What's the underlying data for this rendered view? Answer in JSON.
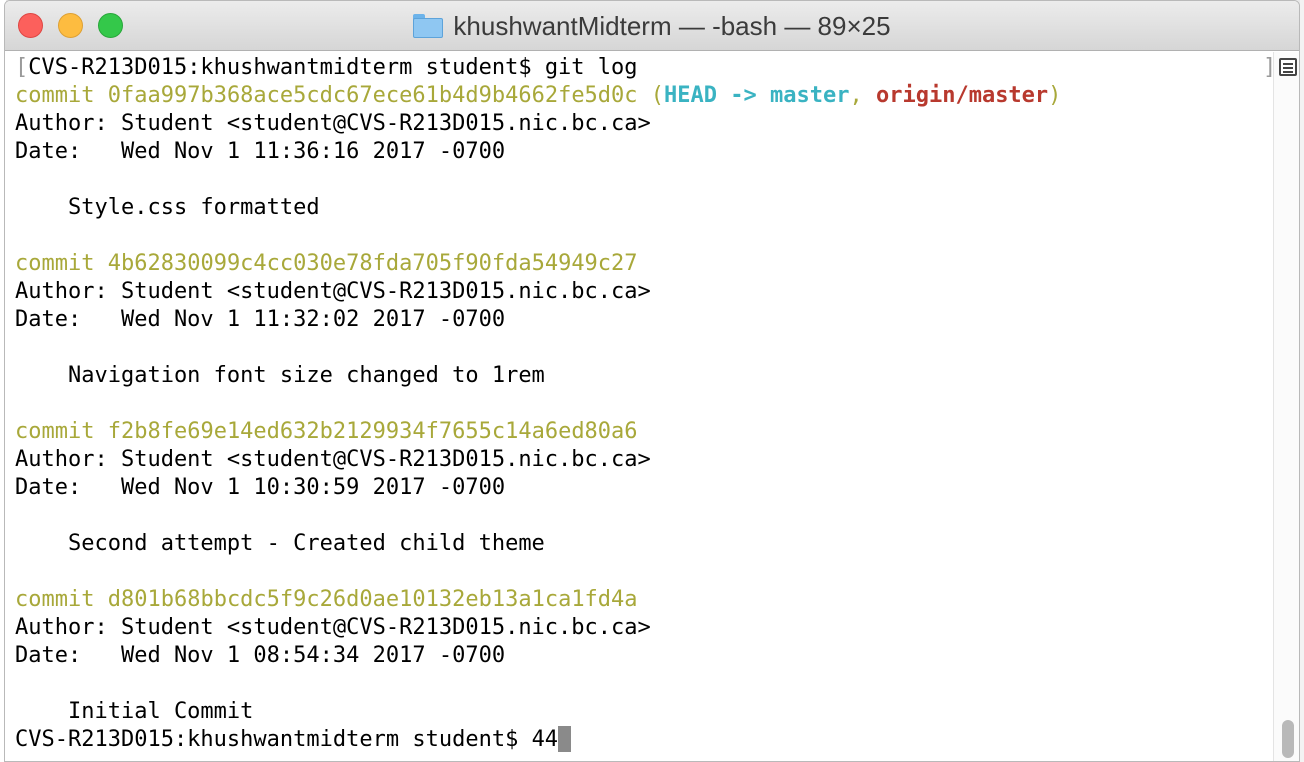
{
  "window": {
    "title": "khushwantMidterm — -bash — 89×25"
  },
  "terminal": {
    "prompt_line": {
      "prompt": "CVS-R213D015:khushwantmidterm student$ ",
      "command": "git log"
    },
    "commits": [
      {
        "label": "commit",
        "hash": "0faa997b368ace5cdc67ece61b4d9b4662fe5d0c",
        "refs": {
          "open": "(",
          "head": "HEAD -> master",
          "sep": ", ",
          "origin": "origin/master",
          "close": ")"
        },
        "author": "Author: Student <student@CVS-R213D015.nic.bc.ca>",
        "date": "Date:   Wed Nov 1 11:36:16 2017 -0700",
        "message": "    Style.css formatted"
      },
      {
        "label": "commit",
        "hash": "4b62830099c4cc030e78fda705f90fda54949c27",
        "author": "Author: Student <student@CVS-R213D015.nic.bc.ca>",
        "date": "Date:   Wed Nov 1 11:32:02 2017 -0700",
        "message": "    Navigation font size changed to 1rem"
      },
      {
        "label": "commit",
        "hash": "f2b8fe69e14ed632b2129934f7655c14a6ed80a6",
        "author": "Author: Student <student@CVS-R213D015.nic.bc.ca>",
        "date": "Date:   Wed Nov 1 10:30:59 2017 -0700",
        "message": "    Second attempt - Created child theme"
      },
      {
        "label": "commit",
        "hash": "d801b68bbcdc5f9c26d0ae10132eb13a1ca1fd4a",
        "author": "Author: Student <student@CVS-R213D015.nic.bc.ca>",
        "date": "Date:   Wed Nov 1 08:54:34 2017 -0700",
        "message": "    Initial Commit"
      }
    ],
    "final_prompt": {
      "prompt": "CVS-R213D015:khushwantmidterm student$ ",
      "input": "44"
    }
  },
  "colors": {
    "commit": "#a8a83a",
    "head": "#3ab3c2",
    "branch": "#3aa83a",
    "origin": "#b8392e"
  },
  "icons": {
    "title": "folder-icon",
    "scrollbar_menu": "marker-menu-icon"
  }
}
